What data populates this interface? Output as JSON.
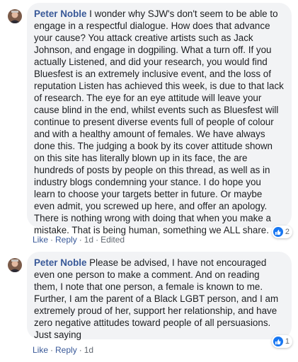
{
  "comments": [
    {
      "author": "Peter Noble",
      "text": "I wonder why SJW's don't seem to be able to engage in a respectful dialogue. How does that advance your cause? You attack creative artists such as Jack Johnson, and engage in dogpiling. What a turn off. If you actually Listened, and did your research, you would find Bluesfest is an extremely inclusive event, and the loss of reputation Listen has achieved this week, is due to that lack of research. The eye for an eye attitude will leave your cause blind in the end, whilst events such as Bluesfest will continue to present diverse events full of people of colour and with a healthy amount of females. We have always done this. The judging a book by its cover attitude shown on this site has literally blown up in its face, the are hundreds of posts by people on this thread, as well as in industry blogs condemning your stance. I do hope you learn to choose your targets better in future. Or maybe even admit, you screwed up here, and offer an apology. There is nothing wrong with doing that when you make a mistake. That is being human, something we ALL share.",
      "like_label": "Like",
      "reply_label": "Reply",
      "time": "1d",
      "edited": "Edited",
      "reaction_count": "2"
    },
    {
      "author": "Peter Noble",
      "text": "Please be advised, I have not encouraged even one person to make a comment. And on reading them, I note that one person, a female is known to me. Further, I am the parent of a Black LGBT person, and I am extremely proud of her, support her relationship, and have zero negative attitudes toward people of all persuasions. Just saying",
      "like_label": "Like",
      "reply_label": "Reply",
      "time": "1d",
      "reaction_count": "1"
    }
  ],
  "separator": "·",
  "icons": {
    "avatar": "avatar-icon",
    "reaction": "like-reaction-icon"
  },
  "colors": {
    "author": "#385898",
    "bubble": "#f2f3f5",
    "like_badge": "#1877f2"
  }
}
